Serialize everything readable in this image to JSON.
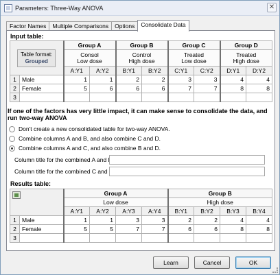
{
  "window": {
    "title": "Parameters: Three-Way ANOVA",
    "close_glyph": "✕"
  },
  "tabs": [
    {
      "label": "Factor Names",
      "active": false
    },
    {
      "label": "Multiple Comparisons",
      "active": false
    },
    {
      "label": "Options",
      "active": false
    },
    {
      "label": "Consolidate Data",
      "active": true
    }
  ],
  "input_table": {
    "heading": "Input table:",
    "corner_label": "Table format:",
    "corner_value": "Grouped",
    "groups": [
      {
        "name": "Group A",
        "line1": "Consol",
        "line2": "Low dose",
        "columns": [
          "A:Y1",
          "A:Y2"
        ]
      },
      {
        "name": "Group B",
        "line1": "Control",
        "line2": "High dose",
        "columns": [
          "B:Y1",
          "B:Y2"
        ]
      },
      {
        "name": "Group C",
        "line1": "Treated",
        "line2": "Low dose",
        "columns": [
          "C:Y1",
          "C:Y2"
        ]
      },
      {
        "name": "Group D",
        "line1": "Treated",
        "line2": "High dose",
        "columns": [
          "D:Y1",
          "D:Y2"
        ]
      }
    ],
    "x_marker": "×",
    "rows": [
      {
        "num": "1",
        "label": "Male",
        "values": [
          "1",
          "1",
          "2",
          "2",
          "3",
          "3",
          "4",
          "4"
        ]
      },
      {
        "num": "2",
        "label": "Female",
        "values": [
          "5",
          "6",
          "6",
          "6",
          "7",
          "7",
          "8",
          "8"
        ]
      },
      {
        "num": "3",
        "label": "",
        "values": [
          "",
          "",
          "",
          "",
          "",
          "",
          "",
          ""
        ]
      }
    ]
  },
  "question": "If one of the factors has very little impact, it can make sense to consolidate the data, and run two-way ANOVA",
  "options": [
    {
      "label": "Don't create a new consolidated table for two-way ANOVA.",
      "checked": false
    },
    {
      "label": "Combine columns A and B, and also combine C and D.",
      "checked": false
    },
    {
      "label": "Combine columns A and C, and also combine B and D.",
      "checked": true
    }
  ],
  "fields": [
    {
      "label": "Column title for the combined A and B:",
      "value": ""
    },
    {
      "label": "Column title for the combined C and D:",
      "value": ""
    }
  ],
  "results_table": {
    "heading": "Results table:",
    "groups": [
      {
        "name": "Group A",
        "subtitle": "Low dose",
        "columns": [
          "A:Y1",
          "A:Y2",
          "A:Y3",
          "A:Y4"
        ]
      },
      {
        "name": "Group B",
        "subtitle": "High dose",
        "columns": [
          "B:Y1",
          "B:Y2",
          "B:Y3",
          "B:Y4"
        ]
      }
    ],
    "x_marker": "×",
    "rows": [
      {
        "num": "1",
        "label": "Male",
        "values": [
          "1",
          "1",
          "3",
          "3",
          "2",
          "2",
          "4",
          "4"
        ]
      },
      {
        "num": "2",
        "label": "Female",
        "values": [
          "5",
          "5",
          "7",
          "7",
          "6",
          "6",
          "8",
          "8"
        ]
      },
      {
        "num": "3",
        "label": "",
        "values": [
          "",
          "",
          "",
          "",
          "",
          "",
          "",
          ""
        ]
      }
    ]
  },
  "buttons": {
    "learn": "Learn",
    "cancel": "Cancel",
    "ok": "OK"
  }
}
